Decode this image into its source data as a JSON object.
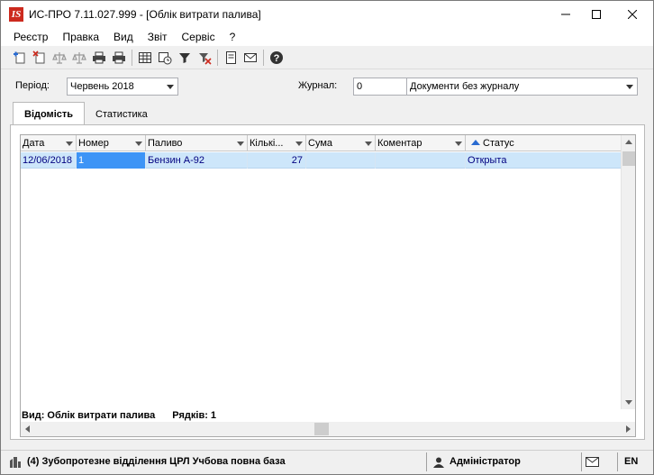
{
  "window": {
    "title": "ИС-ПРО 7.11.027.999 - [Облік витрати палива]",
    "logo_text": "IS"
  },
  "menu": [
    "Реєстр",
    "Правка",
    "Вид",
    "Звіт",
    "Сервіс",
    "?"
  ],
  "toolbar": {
    "icons": [
      "add-document-icon",
      "delete-document-icon",
      "scales-icon",
      "scales-down-icon",
      "print-icon",
      "print-preview-icon",
      "table-grid-icon",
      "calendar-clock-icon",
      "filter-icon",
      "clear-filter-icon",
      "document-icon",
      "email-icon",
      "help-icon"
    ]
  },
  "filters": {
    "period_label": "Період:",
    "period_value": "Червень 2018",
    "journal_label": "Журнал:",
    "journal_code": "0",
    "journal_value": "Документи без журналу"
  },
  "tabs": [
    {
      "label": "Відомість",
      "active": true
    },
    {
      "label": "Статистика",
      "active": false
    }
  ],
  "grid": {
    "columns": [
      "Дата",
      "Номер",
      "Паливо",
      "Кількі...",
      "Сума",
      "Коментар",
      "Статус"
    ],
    "rows": [
      {
        "date": "12/06/2018",
        "number": "1",
        "fuel": "Бензин А-92",
        "quantity": "27",
        "sum": "",
        "comment": "",
        "status": "Открыта"
      }
    ],
    "footer_view": "Вид: Облік витрати палива",
    "footer_rows": "Рядків: 1"
  },
  "statusbar": {
    "company": "(4) Зубопротезне відділення ЦРЛ Учбова повна база",
    "user": "Адміністратор",
    "lang": "EN"
  },
  "colors": {
    "logo": "#cc2a1e",
    "selection": "#cde6fa",
    "selected_cell": "#3d94f6",
    "sort_arrow": "#2a6bd1"
  }
}
